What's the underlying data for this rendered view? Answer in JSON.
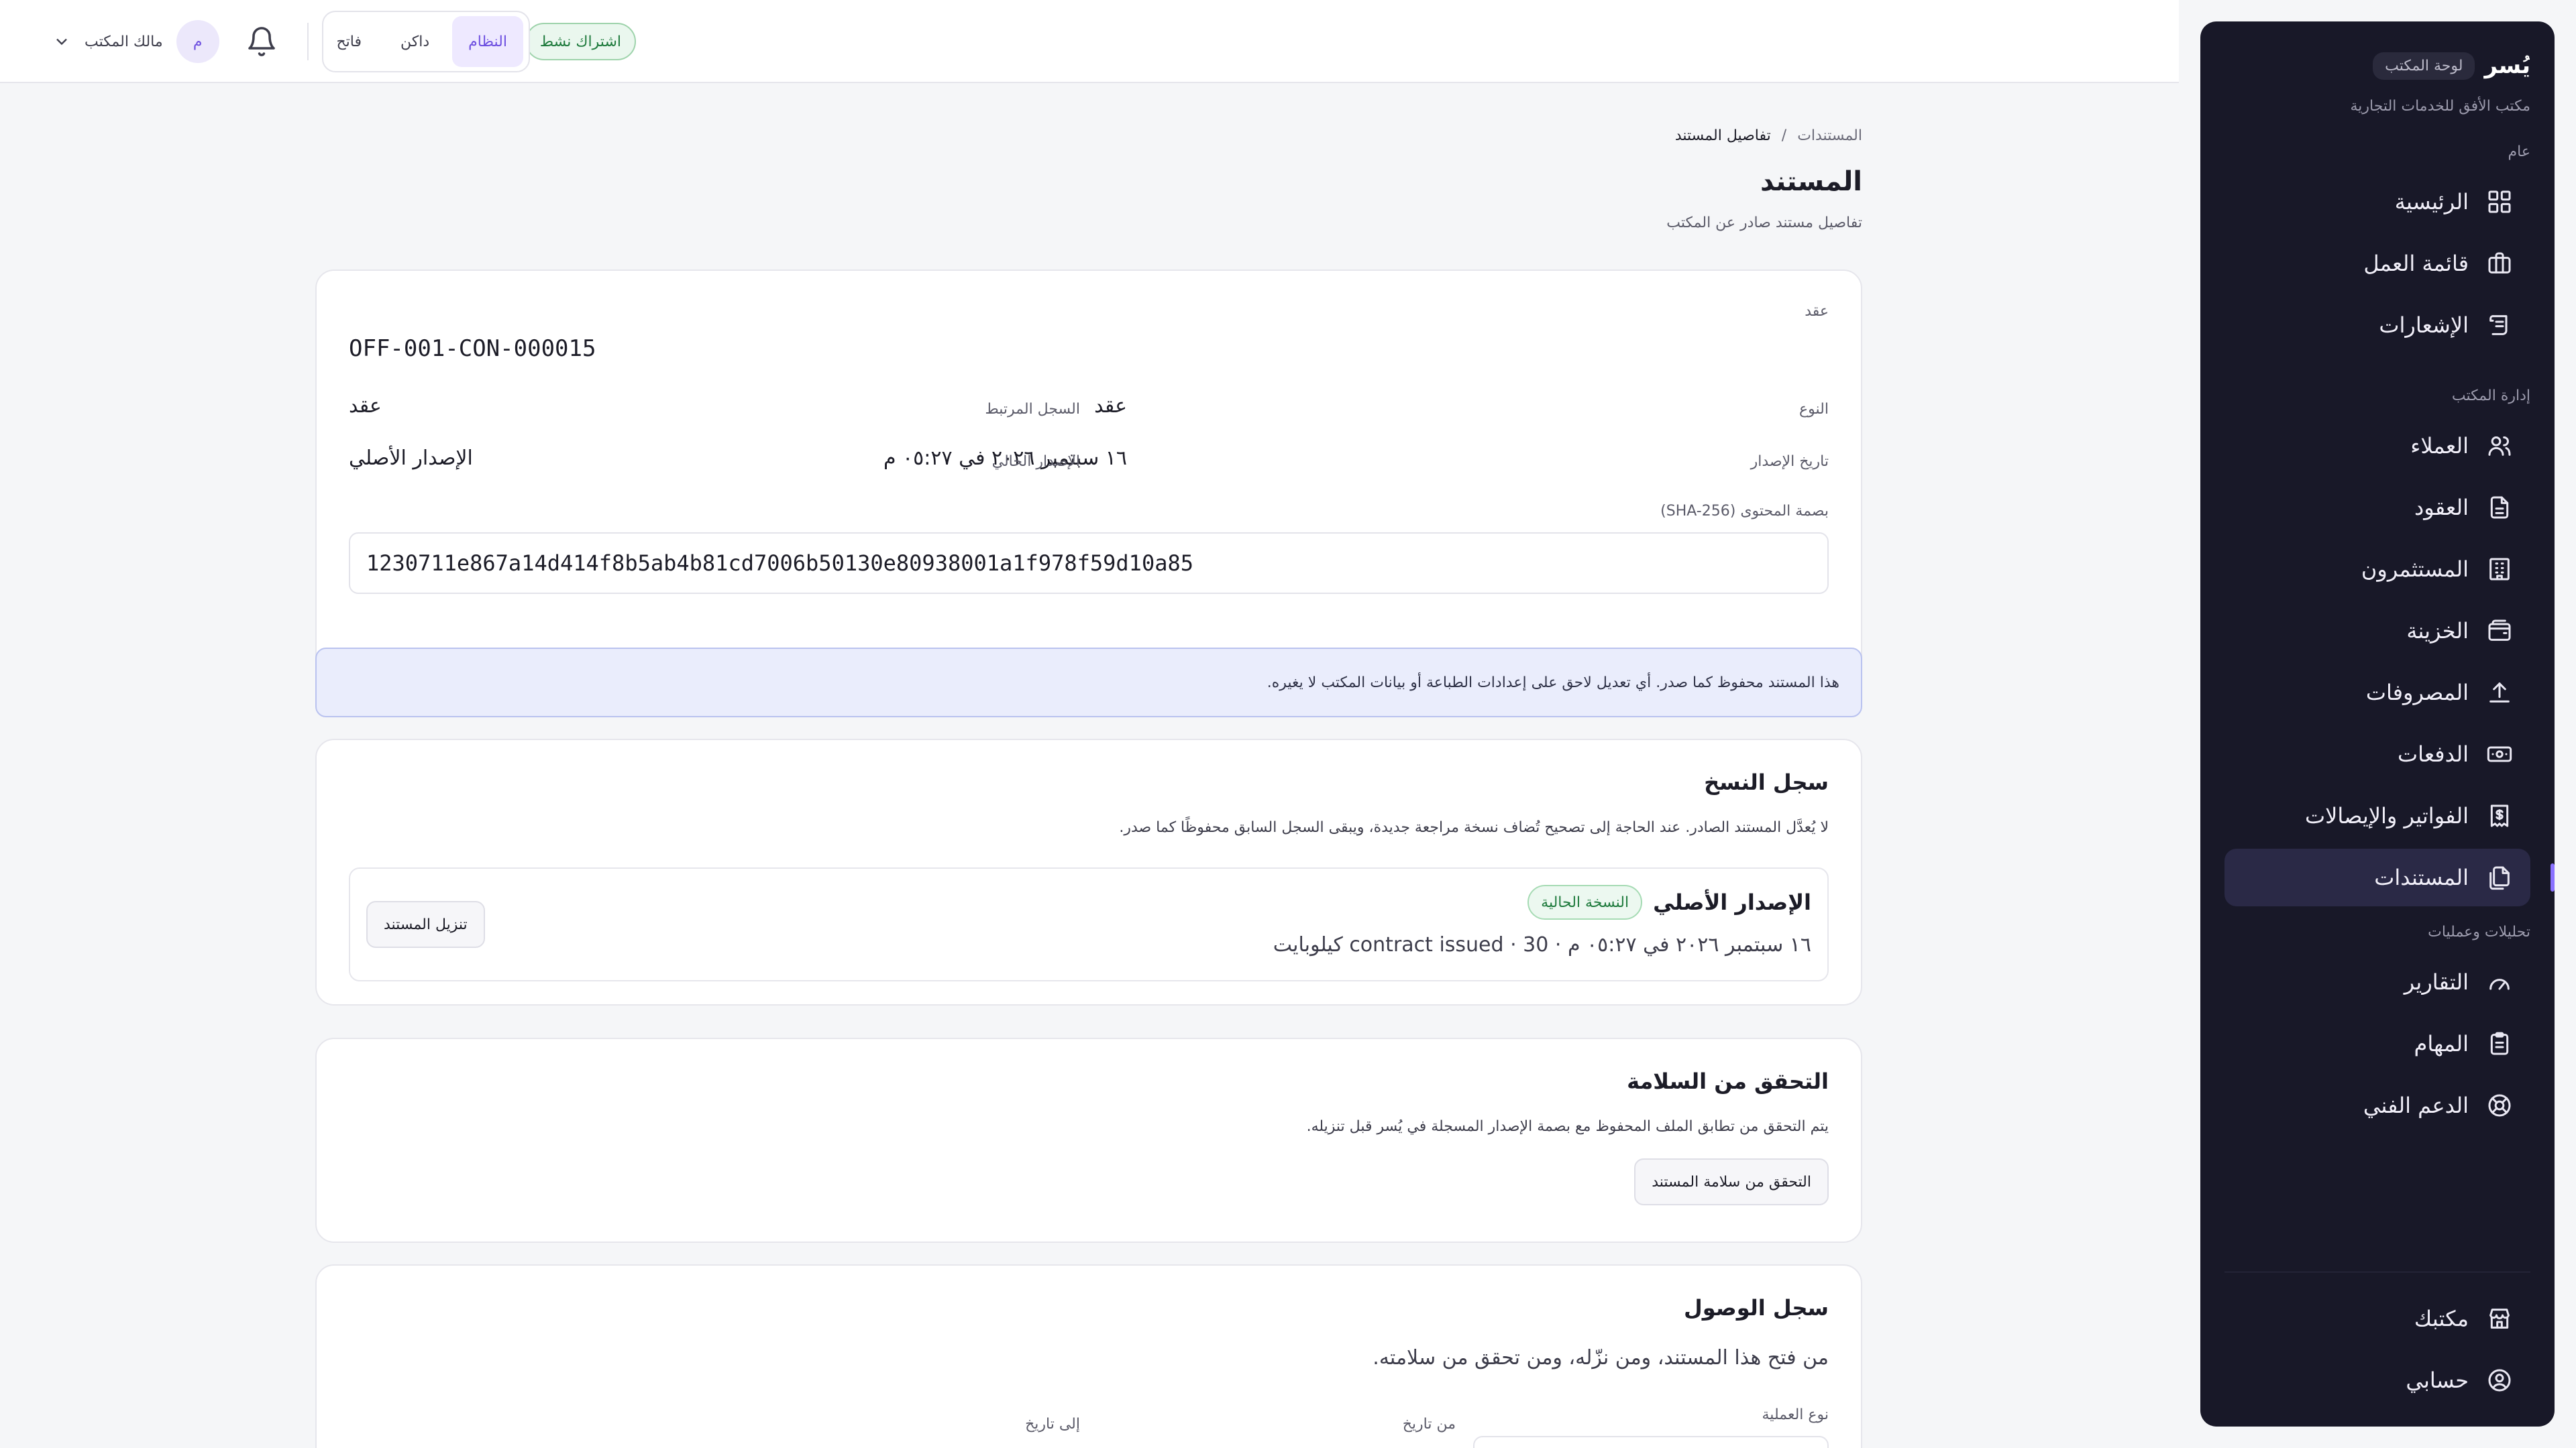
{
  "sidebar": {
    "brand": "يُسر",
    "brand_tag": "لوحة المكتب",
    "office_name": "مكتب الأفق للخدمات التجارية",
    "sections": {
      "general": "عام",
      "office_management": "إدارة المكتب",
      "analytics": "تحليلات وعمليات"
    },
    "items": {
      "home": "الرئيسية",
      "work_queue": "قائمة العمل",
      "notifications": "الإشعارات",
      "clients": "العملاء",
      "contracts": "العقود",
      "investors": "المستثمرون",
      "treasury": "الخزينة",
      "expenses": "المصروفات",
      "payments": "الدفعات",
      "invoices": "الفواتير والإيصالات",
      "documents": "المستندات",
      "reports": "التقارير",
      "tasks": "المهام",
      "support": "الدعم الفني",
      "my_office": "مكتبك",
      "my_account": "حسابي"
    },
    "active_item": "documents"
  },
  "topbar": {
    "subscription": "اشتراك نشط",
    "theme": {
      "system": "النظام",
      "dark": "داكن",
      "light": "فاتح",
      "selected": "system"
    },
    "user": {
      "initial": "م",
      "role": "مالك المكتب"
    }
  },
  "page": {
    "breadcrumb": {
      "parent": "المستندات",
      "separator": "/",
      "current": "تفاصيل المستند"
    },
    "title": "المستند",
    "subtitle": "تفاصيل مستند صادر عن المكتب"
  },
  "document": {
    "kind_label": "عقد",
    "number": "OFF-001-CON-000015",
    "type_label": "النوع",
    "type_value": "عقد",
    "linked_label": "السجل المرتبط",
    "linked_value": "عقد",
    "issue_date_label": "تاريخ الإصدار",
    "issue_date_value": "١٦ سبتمبر ٢٠٢٦ في ٠٥:٢٧ م",
    "current_version_label": "الإصدار الحالي",
    "current_version_value": "الإصدار الأصلي",
    "hash_label": "بصمة المحتوى (SHA-256)",
    "hash_value": "1230711e867a14d414f8b5ab4b81cd7006b50130e80938001a1f978f59d10a85"
  },
  "notice": "هذا المستند محفوظ كما صدر. أي تعديل لاحق على إعدادات الطباعة أو بيانات المكتب لا يغيره.",
  "versions": {
    "title": "سجل النسخ",
    "description": "لا يُعدَّل المستند الصادر. عند الحاجة إلى تصحيح تُضاف نسخة مراجعة جديدة، ويبقى السجل السابق محفوظًا كما صدر.",
    "items": [
      {
        "name": "الإصدار الأصلي",
        "badge": "النسخة الحالية",
        "meta": "١٦ سبتمبر ٢٠٢٦ في ٠٥:٢٧ م · contract issued · 30 كيلوبايت",
        "download_label": "تنزيل المستند"
      }
    ]
  },
  "integrity": {
    "title": "التحقق من السلامة",
    "description": "يتم التحقق من تطابق الملف المحفوظ مع بصمة الإصدار المسجلة في يُسر قبل تنزيله.",
    "button": "التحقق من سلامة المستند"
  },
  "access_log": {
    "title": "سجل الوصول",
    "description": "من فتح هذا المستند، ومن نزّله، ومن تحقق من سلامته.",
    "filters": {
      "operation_type": "نوع العملية",
      "from_date": "من تاريخ",
      "to_date": "إلى تاريخ"
    }
  },
  "colors": {
    "sidebar_bg": "#181828",
    "accent": "#6d4fe0",
    "success": "#1e7a3c",
    "notice_bg": "#eaedfc"
  }
}
